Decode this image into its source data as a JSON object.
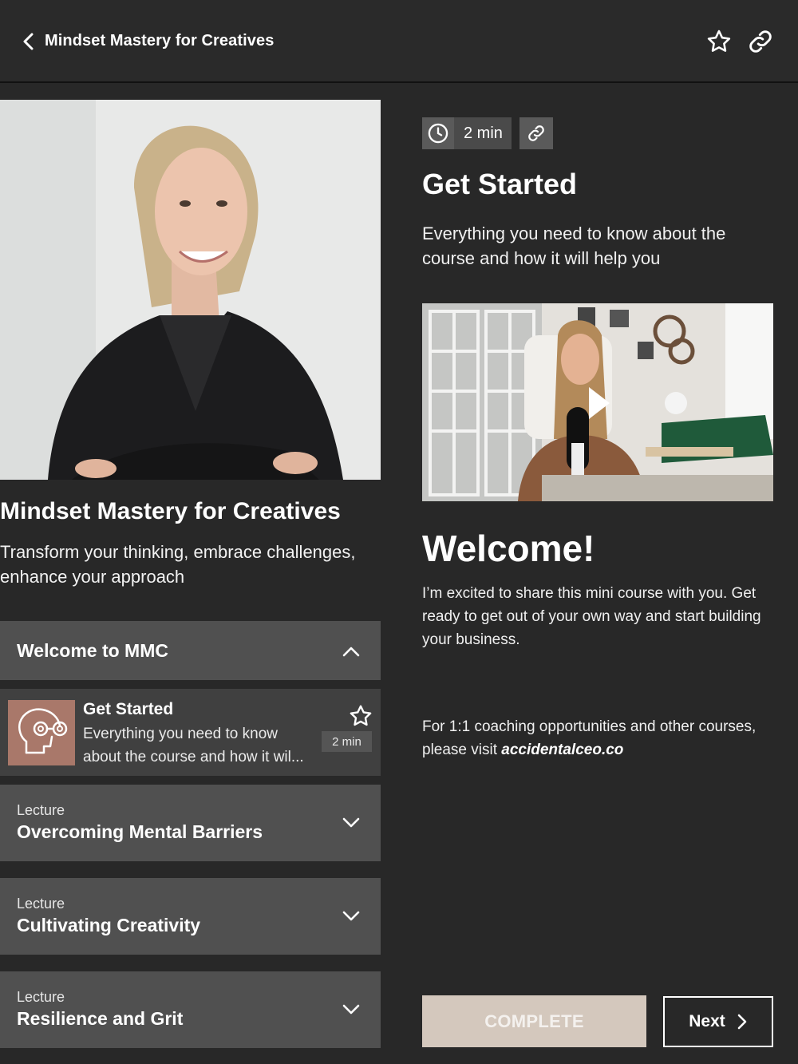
{
  "header": {
    "title": "Mindset Mastery for Creatives"
  },
  "course": {
    "title": "Mindset Mastery for Creatives",
    "subtitle": "Transform your thinking, embrace challenges, enhance your approach"
  },
  "curriculum": {
    "section_title": "Welcome to MMC",
    "active_lesson": {
      "title": "Get Started",
      "description": "Everything you need to know about the course and how it wil...",
      "duration": "2 min"
    },
    "lectures": [
      {
        "kind": "Lecture",
        "name": "Overcoming Mental Barriers"
      },
      {
        "kind": "Lecture",
        "name": "Cultivating Creativity"
      },
      {
        "kind": "Lecture",
        "name": "Resilience and Grit"
      }
    ]
  },
  "lesson": {
    "duration": "2 min",
    "title": "Get Started",
    "description": "Everything you need to know about the course and how it will help you",
    "welcome_heading": "Welcome!",
    "welcome_body": "I’m excited to share this mini course with you. Get ready to get out of your own way and start building your business.",
    "coaching_text": "For 1:1 coaching opportunities and other courses, please visit ",
    "coaching_site": "accidentalceo.co"
  },
  "actions": {
    "complete_label": "COMPLETE",
    "next_label": "Next"
  },
  "colors": {
    "background": "#282828",
    "panel": "#505050",
    "complete_button": "#d4c8bd",
    "thumb_accent": "#a9786a"
  }
}
